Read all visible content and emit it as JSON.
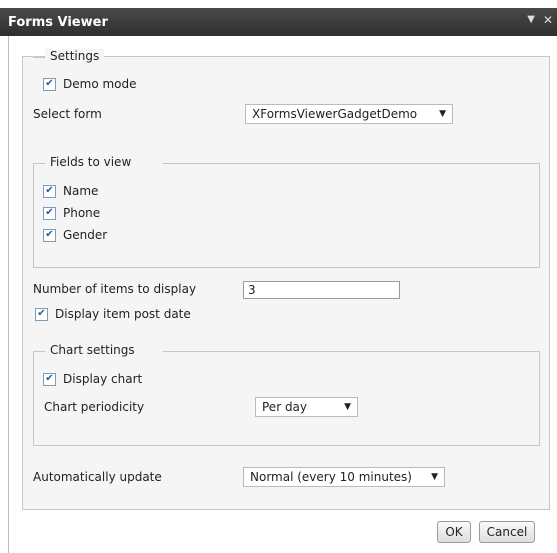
{
  "window": {
    "title": "Forms Viewer",
    "menu_icon": "▼",
    "close_icon": "✕"
  },
  "settings": {
    "legend": "Settings",
    "demo_mode": {
      "label": "Demo mode",
      "checked": true
    },
    "select_form": {
      "label": "Select form",
      "value": "XFormsViewerGadgetDemo"
    },
    "fields": {
      "legend": "Fields to view",
      "items": [
        {
          "label": "Name",
          "checked": true
        },
        {
          "label": "Phone",
          "checked": true
        },
        {
          "label": "Gender",
          "checked": true
        }
      ]
    },
    "items_count": {
      "label": "Number of items to display",
      "value": "3"
    },
    "post_date": {
      "label": "Display item post date",
      "checked": true
    },
    "chart": {
      "legend": "Chart settings",
      "display_chart": {
        "label": "Display chart",
        "checked": true
      },
      "periodicity": {
        "label": "Chart periodicity",
        "value": "Per day"
      }
    },
    "auto_update": {
      "label": "Automatically update",
      "value": "Normal (every 10 minutes)"
    }
  },
  "buttons": {
    "ok": "OK",
    "cancel": "Cancel"
  }
}
